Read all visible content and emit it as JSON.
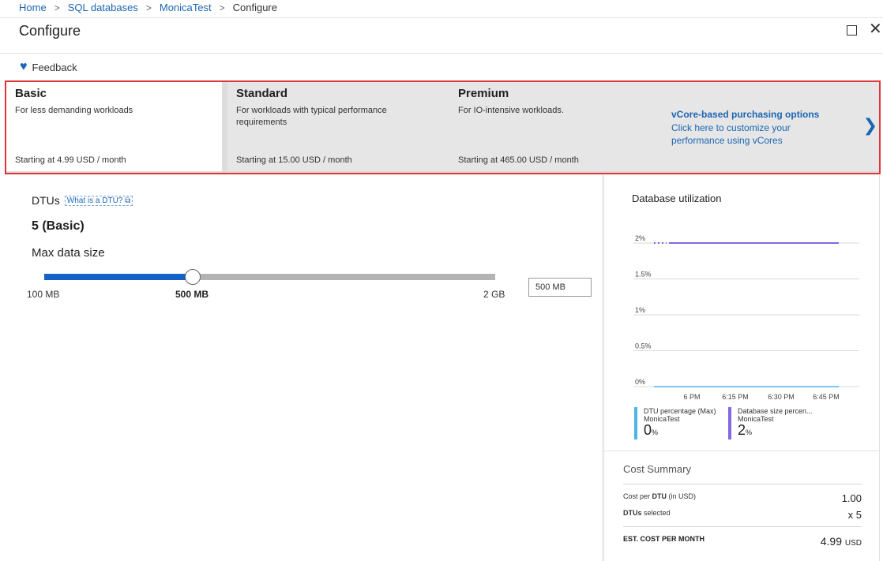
{
  "breadcrumb": {
    "items": [
      "Home",
      "SQL databases",
      "MonicaTest"
    ],
    "current": "Configure"
  },
  "header": {
    "title": "Configure"
  },
  "toolbar": {
    "feedback_label": "Feedback"
  },
  "tiers": [
    {
      "name": "Basic",
      "desc": "For less demanding workloads",
      "price": "Starting at 4.99 USD / month"
    },
    {
      "name": "Standard",
      "desc": "For workloads with typical performance requirements",
      "price": "Starting at 15.00 USD / month"
    },
    {
      "name": "Premium",
      "desc": "For IO-intensive workloads.",
      "price": "Starting at 465.00 USD / month"
    }
  ],
  "vcore": {
    "title": "vCore-based purchasing options",
    "desc": "Click here to customize your performance using vCores"
  },
  "dtu": {
    "label": "DTUs",
    "link": "What is a DTU? ⧉",
    "value": "5 (Basic)"
  },
  "max_size": {
    "label": "Max data size",
    "min": "100 MB",
    "selected": "500 MB",
    "max": "2 GB",
    "input_value": "500 MB",
    "slider_fraction": 0.33
  },
  "utilization": {
    "title": "Database utilization",
    "y_ticks": [
      "2%",
      "1.5%",
      "1%",
      "0.5%",
      "0%"
    ],
    "x_ticks": [
      "6 PM",
      "6:15 PM",
      "6:30 PM",
      "6:45 PM"
    ],
    "legend": [
      {
        "name": "DTU percentage (Max)",
        "sub": "MonicaTest",
        "value": "0",
        "unit": "%",
        "color": "#4db4e8"
      },
      {
        "name": "Database size percen...",
        "sub": "MonicaTest",
        "value": "2",
        "unit": "%",
        "color": "#8667e0"
      }
    ]
  },
  "chart_data": {
    "type": "line",
    "title": "Database utilization",
    "ylim": [
      0,
      2
    ],
    "yticks": [
      "0%",
      "0.5%",
      "1%",
      "1.5%",
      "2%"
    ],
    "xticks": [
      "6 PM",
      "6:15 PM",
      "6:30 PM",
      "6:45 PM"
    ],
    "series": [
      {
        "name": "DTU percentage (Max)",
        "x": [
          "5:55 PM",
          "6:52 PM"
        ],
        "values": [
          0,
          0
        ],
        "color": "#4db4e8"
      },
      {
        "name": "Database size percen...",
        "x": [
          "5:55 PM",
          "6:52 PM"
        ],
        "values": [
          2,
          2
        ],
        "color": "#8667e0"
      }
    ]
  },
  "cost": {
    "title": "Cost Summary",
    "rows": [
      {
        "label_pre": "Cost per ",
        "label_bold": "DTU",
        "label_post": " (in USD)",
        "value": "1.00"
      },
      {
        "label_pre": "",
        "label_bold": "DTUs",
        "label_post": " selected",
        "value": "x 5"
      }
    ],
    "est_label": "EST. COST PER MONTH",
    "est_value": "4.99",
    "est_currency": "USD"
  }
}
